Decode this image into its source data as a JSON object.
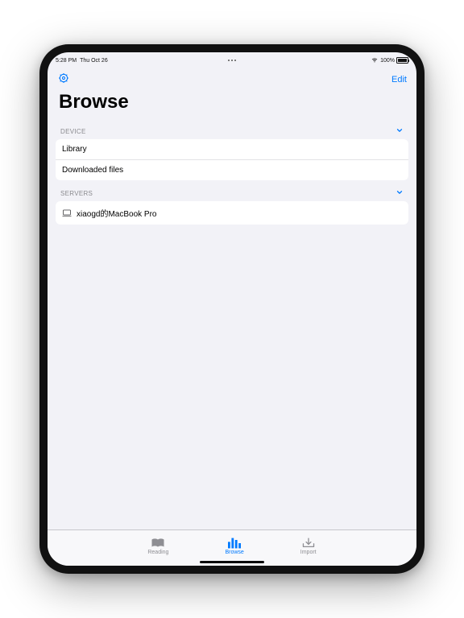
{
  "statusbar": {
    "time": "5:28 PM",
    "date": "Thu Oct 26",
    "battery_pct": "100%"
  },
  "toolbar": {
    "edit_label": "Edit"
  },
  "page": {
    "title": "Browse"
  },
  "sections": {
    "device": {
      "header": "DEVICE",
      "items": [
        {
          "label": "Library"
        },
        {
          "label": "Downloaded files"
        }
      ]
    },
    "servers": {
      "header": "SERVERS",
      "items": [
        {
          "label": "xiaogd的MacBook Pro"
        }
      ]
    }
  },
  "tabs": {
    "reading": "Reading",
    "browse": "Browse",
    "import": "Import"
  }
}
